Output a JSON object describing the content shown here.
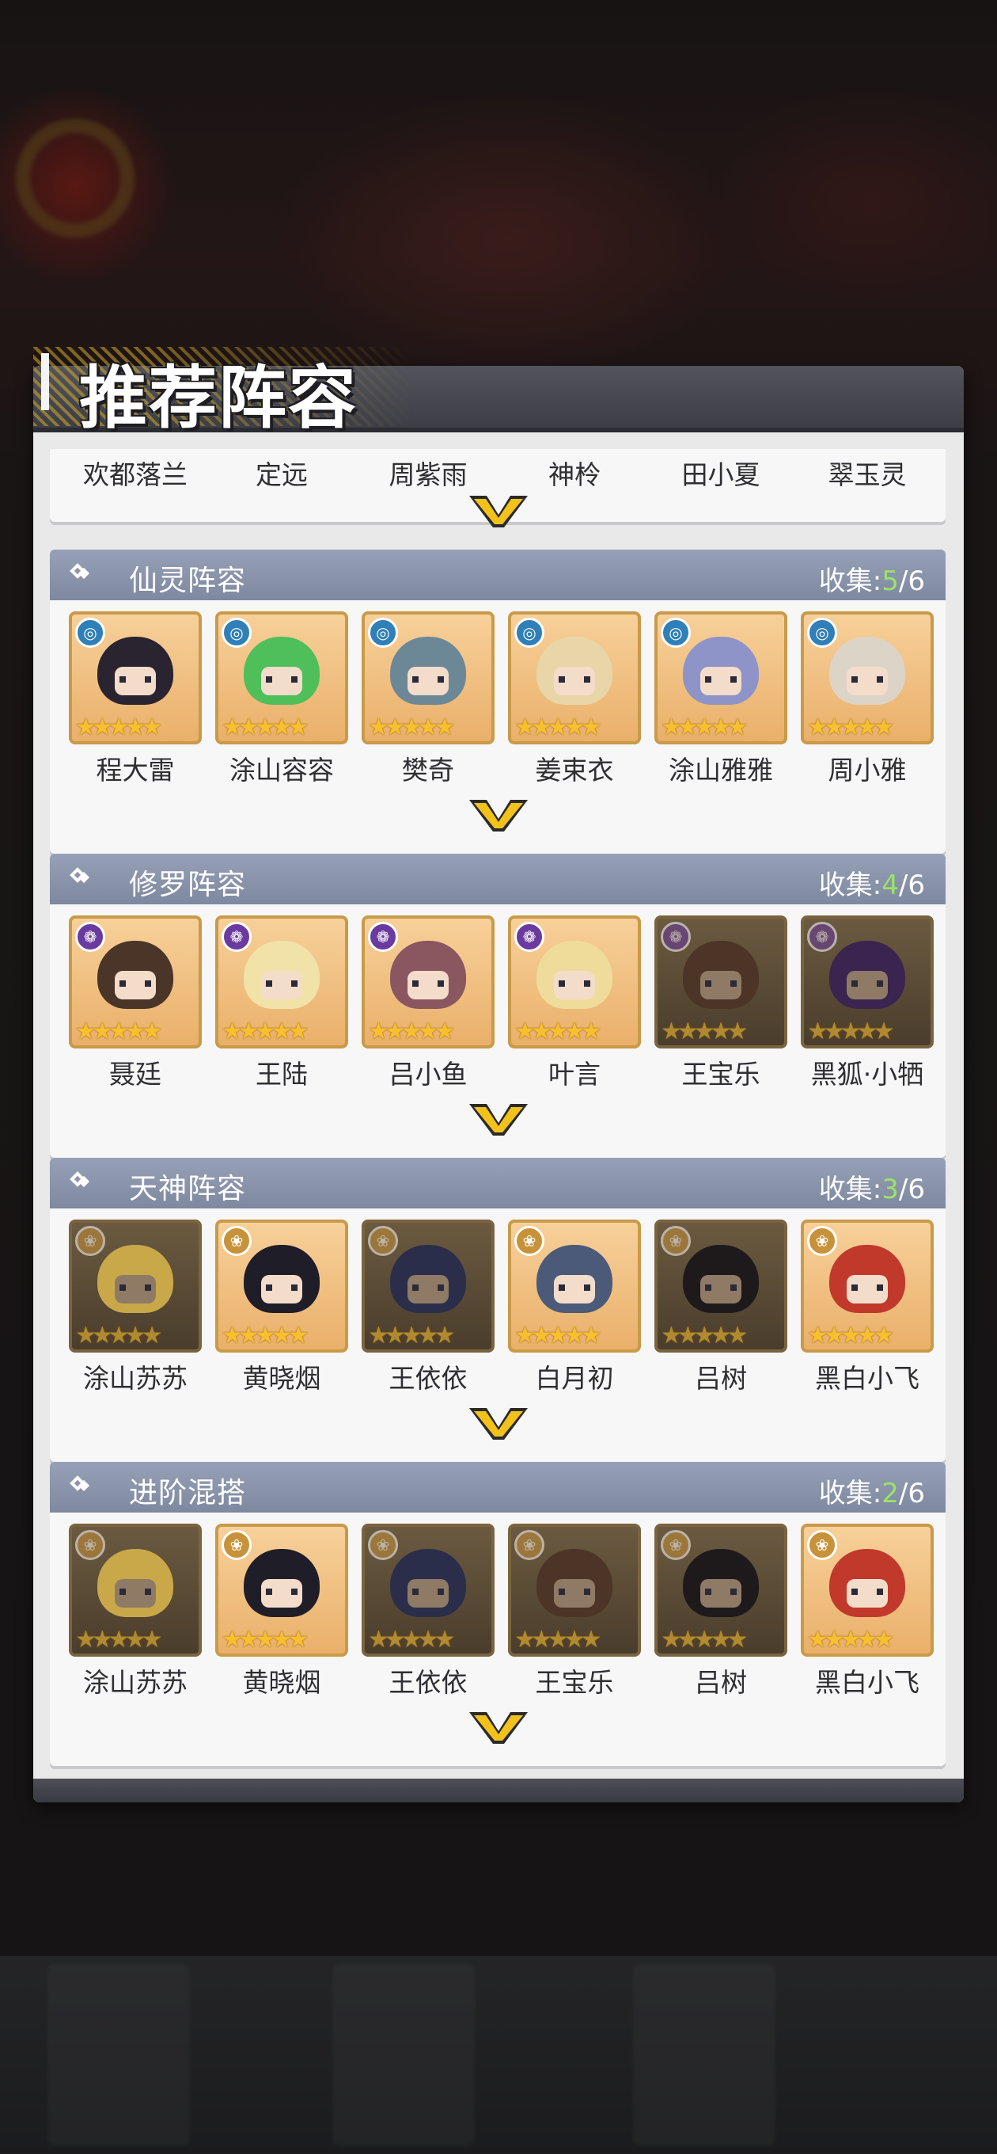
{
  "panel": {
    "title": "推荐阵容"
  },
  "top_row": {
    "names": [
      "欢都落兰",
      "定远",
      "周紫雨",
      "神柃",
      "田小夏",
      "翠玉灵"
    ]
  },
  "sections": [
    {
      "title": "仙灵阵容",
      "count_label": "收集:",
      "count_current": "5",
      "count_total": "/6",
      "element": "water",
      "characters": [
        {
          "name": "程大雷",
          "lit": true,
          "hair": "#2a2430"
        },
        {
          "name": "涂山容容",
          "lit": true,
          "hair": "#4fbf5a"
        },
        {
          "name": "樊奇",
          "lit": true,
          "hair": "#6c8896"
        },
        {
          "name": "姜束衣",
          "lit": true,
          "hair": "#e8d6a8"
        },
        {
          "name": "涂山雅雅",
          "lit": true,
          "hair": "#8e93c8"
        },
        {
          "name": "周小雅",
          "lit": true,
          "hair": "#ddd4c8"
        }
      ]
    },
    {
      "title": "修罗阵容",
      "count_label": "收集:",
      "count_current": "4",
      "count_total": "/6",
      "element": "fire",
      "characters": [
        {
          "name": "聂廷",
          "lit": true,
          "hair": "#4a3528"
        },
        {
          "name": "王陆",
          "lit": true,
          "hair": "#f1e2a8"
        },
        {
          "name": "吕小鱼",
          "lit": true,
          "hair": "#8a5660"
        },
        {
          "name": "叶言",
          "lit": true,
          "hair": "#f0dc9a"
        },
        {
          "name": "王宝乐",
          "lit": false,
          "hair": "#4c3526"
        },
        {
          "name": "黑狐·小牺",
          "lit": false,
          "hair": "#3b2450"
        }
      ]
    },
    {
      "title": "天神阵容",
      "count_label": "收集:",
      "count_current": "3",
      "count_total": "/6",
      "element": "lotus",
      "characters": [
        {
          "name": "涂山苏苏",
          "lit": false,
          "hair": "#c9a84a"
        },
        {
          "name": "黄晓烟",
          "lit": true,
          "hair": "#1f1d28"
        },
        {
          "name": "王依依",
          "lit": false,
          "hair": "#2a2e4a"
        },
        {
          "name": "白月初",
          "lit": true,
          "hair": "#4a5a78"
        },
        {
          "name": "吕树",
          "lit": false,
          "hair": "#1e1a1c"
        },
        {
          "name": "黑白小飞",
          "lit": true,
          "hair": "#c0392b"
        }
      ]
    },
    {
      "title": "进阶混搭",
      "count_label": "收集:",
      "count_current": "2",
      "count_total": "/6",
      "element": "lotus",
      "characters": [
        {
          "name": "涂山苏苏",
          "lit": false,
          "hair": "#c9a84a"
        },
        {
          "name": "黄晓烟",
          "lit": true,
          "hair": "#1f1d28"
        },
        {
          "name": "王依依",
          "lit": false,
          "hair": "#2a2e4a"
        },
        {
          "name": "王宝乐",
          "lit": false,
          "hair": "#4c3526"
        },
        {
          "name": "吕树",
          "lit": false,
          "hair": "#1e1a1c"
        },
        {
          "name": "黑白小飞",
          "lit": true,
          "hair": "#c0392b"
        }
      ]
    }
  ],
  "colors": {
    "accent_gold": "#f2c21b",
    "count_highlight": "#9be26a",
    "header_blue_gray": "#8891a6"
  }
}
